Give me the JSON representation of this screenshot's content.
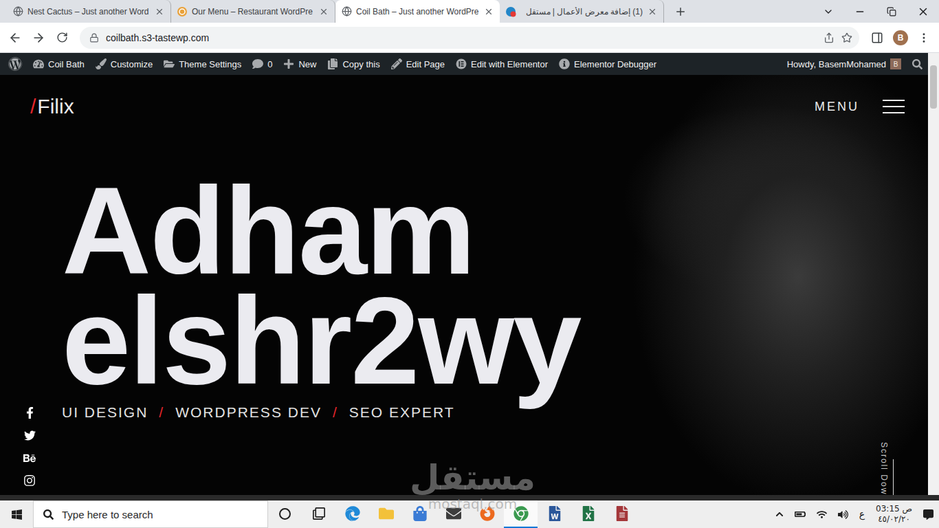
{
  "browser": {
    "tabs": [
      {
        "label": "Nest Cactus – Just another Word",
        "kind": "globe",
        "selected": false
      },
      {
        "label": "Our Menu – Restaurant WordPre",
        "kind": "site",
        "selected": false
      },
      {
        "label": "Coil Bath – Just another WordPre",
        "kind": "globe",
        "selected": true
      },
      {
        "label": "(1) إضافة معرض الأعمال | مستقل",
        "kind": "mostaql",
        "selected": false
      }
    ],
    "address": "coilbath.s3-tastewp.com",
    "profile": "B"
  },
  "admin_bar": {
    "items": [
      {
        "label": "Coil Bath",
        "kind": "dashboard"
      },
      {
        "label": "Customize",
        "kind": "customize"
      },
      {
        "label": "Theme Settings",
        "kind": "settings"
      },
      {
        "label": "0",
        "kind": "comments"
      },
      {
        "label": "New",
        "kind": "new"
      },
      {
        "label": "Copy this",
        "kind": "copy"
      },
      {
        "label": "Edit Page",
        "kind": "edit"
      },
      {
        "label": "Edit with Elementor",
        "kind": "elementor"
      },
      {
        "label": "Elementor Debugger",
        "kind": "debugger"
      }
    ],
    "greeting": "Howdy, BasemMohamed",
    "avatar": "B"
  },
  "site": {
    "logo_mark": "/",
    "logo_text": "Filix",
    "menu": "MENU",
    "heading": [
      "Adham",
      "elshr2wy"
    ],
    "roles": [
      "UI DESIGN",
      "WORDPRESS DEV",
      "SEO EXPERT"
    ],
    "separator": "/",
    "scroll": "Scroll Dow"
  },
  "watermark": {
    "name": "مستقل",
    "site": "mostaql.com"
  },
  "taskbar": {
    "search": {
      "placeholder": "Type here to search"
    },
    "apps": [
      {
        "kind": "cortana",
        "selected": false
      },
      {
        "kind": "taskview",
        "selected": false
      },
      {
        "kind": "edge",
        "selected": false
      },
      {
        "kind": "explorer",
        "selected": false
      },
      {
        "kind": "store",
        "selected": false
      },
      {
        "kind": "mail",
        "selected": false
      },
      {
        "kind": "firefox",
        "selected": false
      },
      {
        "kind": "chrome",
        "selected": true
      },
      {
        "kind": "word",
        "selected": false
      },
      {
        "kind": "excel",
        "selected": false
      },
      {
        "kind": "access",
        "selected": false
      }
    ],
    "language": "ع",
    "time": "03:15 ص",
    "date": "٤٥/٠٢/٢٠"
  }
}
